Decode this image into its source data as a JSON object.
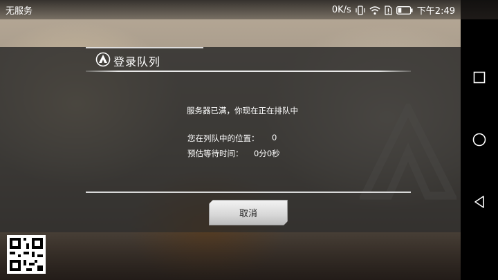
{
  "status_bar": {
    "carrier": "无服务",
    "network_speed": "0K/s",
    "time": "下午2:49",
    "battery_level": 0.3
  },
  "dialog": {
    "title": "登录队列",
    "message": "服务器已满，你现在正在排队中",
    "position_label": "您在列队中的位置：",
    "position_value": "0",
    "wait_label": "预估等待时间：",
    "wait_value": "0分0秒",
    "cancel_label": "取消"
  },
  "nav_bar": {
    "items": [
      "recent-apps",
      "home",
      "back"
    ]
  },
  "colors": {
    "dialog_band": "#262626",
    "button_face": "#d7d7d7",
    "nav_bar": "#000000"
  }
}
